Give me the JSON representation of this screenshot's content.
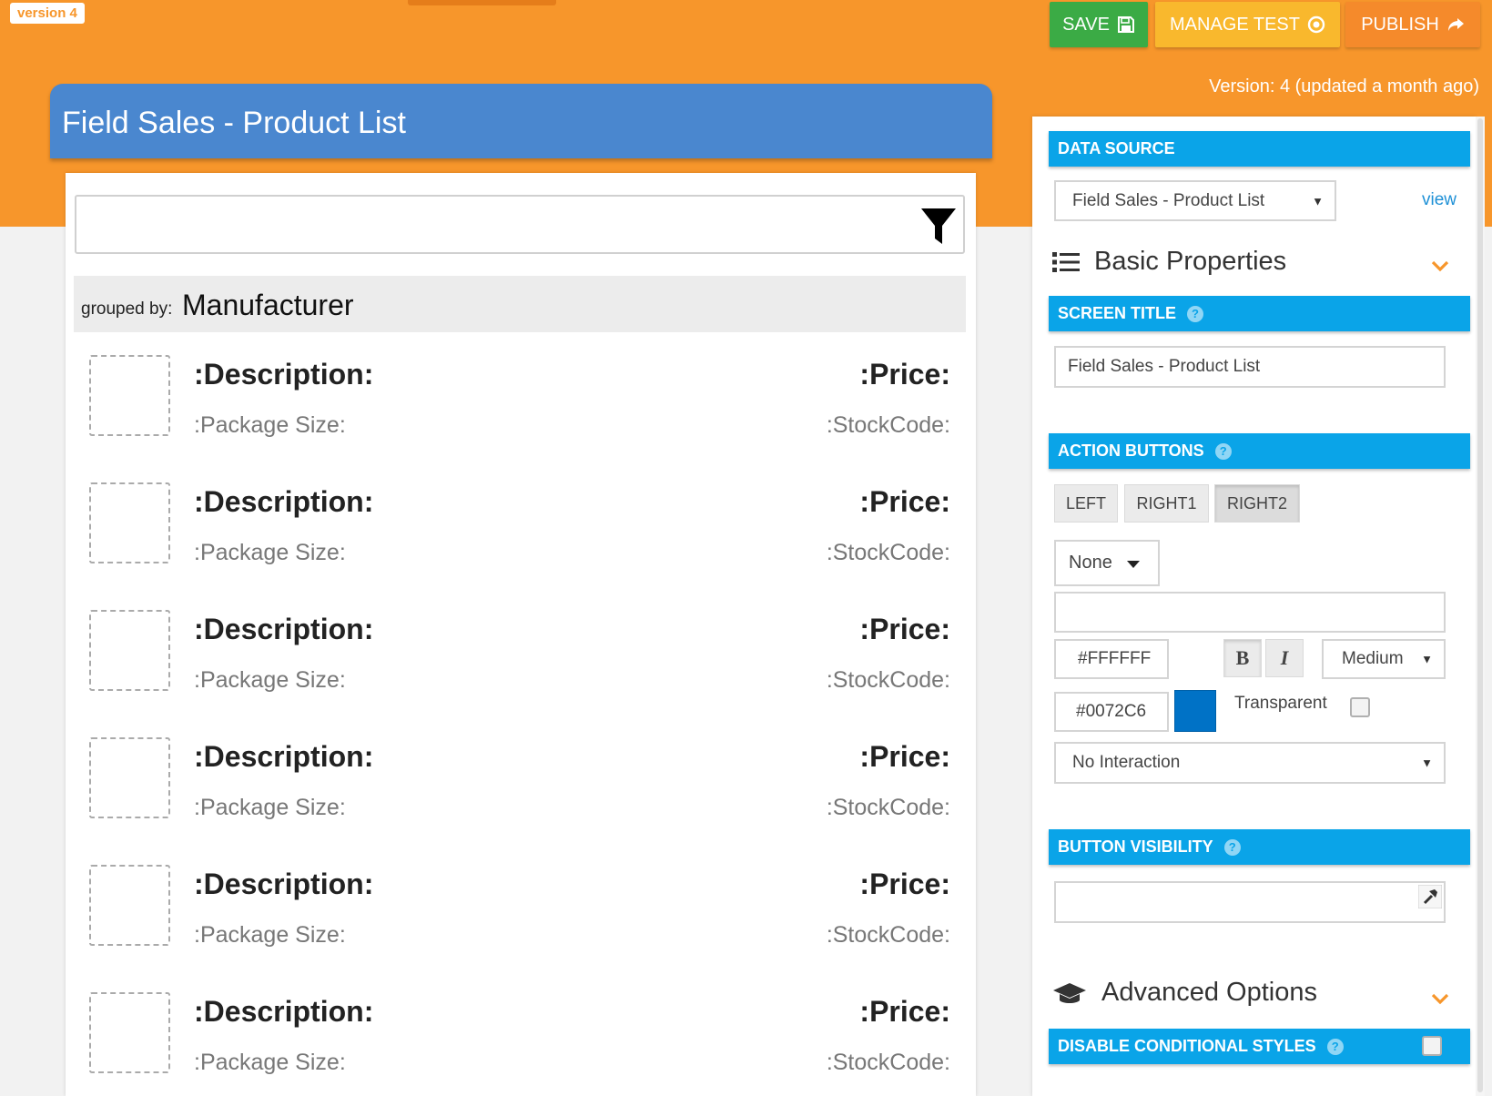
{
  "top_bar": {
    "version_badge": "version 4",
    "save_label": "SAVE",
    "manage_label": "MANAGE TEST",
    "publish_label": "PUBLISH",
    "version_info": "Version: 4 (updated a month ago)"
  },
  "phone": {
    "title": "Field Sales - Product List",
    "filter_value": "",
    "grouped_by_label": "grouped by:",
    "grouped_by_value": "Manufacturer",
    "items": [
      {
        "description": ":Description:",
        "price": ":Price:",
        "package_size": ":Package Size:",
        "stock_code": ":StockCode:"
      },
      {
        "description": ":Description:",
        "price": ":Price:",
        "package_size": ":Package Size:",
        "stock_code": ":StockCode:"
      },
      {
        "description": ":Description:",
        "price": ":Price:",
        "package_size": ":Package Size:",
        "stock_code": ":StockCode:"
      },
      {
        "description": ":Description:",
        "price": ":Price:",
        "package_size": ":Package Size:",
        "stock_code": ":StockCode:"
      },
      {
        "description": ":Description:",
        "price": ":Price:",
        "package_size": ":Package Size:",
        "stock_code": ":StockCode:"
      },
      {
        "description": ":Description:",
        "price": ":Price:",
        "package_size": ":Package Size:",
        "stock_code": ":StockCode:"
      }
    ]
  },
  "panel": {
    "data_source": {
      "header": "DATA SOURCE",
      "selected": "Field Sales - Product List",
      "view_link": "view"
    },
    "basic_properties": {
      "title": "Basic Properties",
      "icon": "list-icon"
    },
    "screen_title": {
      "header": "SCREEN TITLE",
      "value": "Field Sales - Product List"
    },
    "action_buttons": {
      "header": "ACTION BUTTONS",
      "tabs": [
        "LEFT",
        "RIGHT1",
        "RIGHT2"
      ],
      "active_tab": "RIGHT2",
      "icon_select": "None",
      "label_value": "",
      "text_color": "#FFFFFF",
      "bold_label": "B",
      "italic_label": "I",
      "size_select": "Medium",
      "bg_color": "#0072C6",
      "transparent_label": "Transparent",
      "transparent_checked": false,
      "interaction_select": "No Interaction"
    },
    "button_visibility": {
      "header": "BUTTON VISIBILITY",
      "value": ""
    },
    "advanced_options": {
      "title": "Advanced Options",
      "icon": "graduation-cap-icon"
    },
    "disable_conditional_styles": {
      "header": "DISABLE CONDITIONAL STYLES",
      "checked": false
    }
  },
  "colors": {
    "orange": "#f7962b",
    "header_blue": "#4a87cf",
    "section_blue": "#0aa4e8",
    "save_green": "#3bab45",
    "manage_yellow": "#f9b82d",
    "publish_orange": "#f58a2b",
    "swatch_blue": "#0072c6"
  }
}
